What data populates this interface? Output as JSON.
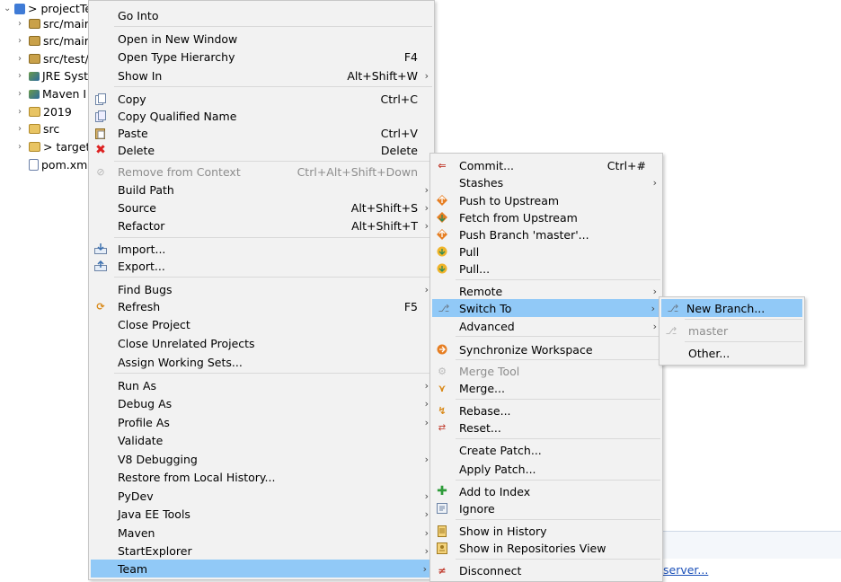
{
  "explorer": {
    "items": [
      {
        "label": "> projectTe",
        "icon": "project-icon"
      },
      {
        "label": "src/mair",
        "icon": "package-folder-icon"
      },
      {
        "label": "src/mair",
        "icon": "package-folder-icon"
      },
      {
        "label": "src/test/",
        "icon": "package-folder-icon"
      },
      {
        "label": "JRE Syst",
        "icon": "library-icon"
      },
      {
        "label": "Maven I",
        "icon": "library-icon"
      },
      {
        "label": "2019",
        "icon": "folder-icon"
      },
      {
        "label": "src",
        "icon": "folder-icon"
      },
      {
        "label": "> target",
        "icon": "folder-icon"
      },
      {
        "label": "pom.xm",
        "icon": "xml-file-icon"
      }
    ]
  },
  "context_menu": {
    "items": [
      {
        "label": "Go Into",
        "shortcut": ""
      },
      {
        "label": "Open in New Window",
        "shortcut": ""
      },
      {
        "label": "Open Type Hierarchy",
        "shortcut": "F4"
      },
      {
        "label": "Show In",
        "shortcut": "Alt+Shift+W"
      },
      {
        "label": "Copy",
        "shortcut": "Ctrl+C"
      },
      {
        "label": "Copy Qualified Name",
        "shortcut": ""
      },
      {
        "label": "Paste",
        "shortcut": "Ctrl+V"
      },
      {
        "label": "Delete",
        "shortcut": "Delete"
      },
      {
        "label": "Remove from Context",
        "shortcut": "Ctrl+Alt+Shift+Down"
      },
      {
        "label": "Build Path",
        "shortcut": ""
      },
      {
        "label": "Source",
        "shortcut": "Alt+Shift+S"
      },
      {
        "label": "Refactor",
        "shortcut": "Alt+Shift+T"
      },
      {
        "label": "Import...",
        "shortcut": ""
      },
      {
        "label": "Export...",
        "shortcut": ""
      },
      {
        "label": "Find Bugs",
        "shortcut": ""
      },
      {
        "label": "Refresh",
        "shortcut": "F5"
      },
      {
        "label": "Close Project",
        "shortcut": ""
      },
      {
        "label": "Close Unrelated Projects",
        "shortcut": ""
      },
      {
        "label": "Assign Working Sets...",
        "shortcut": ""
      },
      {
        "label": "Run As",
        "shortcut": ""
      },
      {
        "label": "Debug As",
        "shortcut": ""
      },
      {
        "label": "Profile As",
        "shortcut": ""
      },
      {
        "label": "Validate",
        "shortcut": ""
      },
      {
        "label": "V8 Debugging",
        "shortcut": ""
      },
      {
        "label": "Restore from Local History...",
        "shortcut": ""
      },
      {
        "label": "PyDev",
        "shortcut": ""
      },
      {
        "label": "Java EE Tools",
        "shortcut": ""
      },
      {
        "label": "Maven",
        "shortcut": ""
      },
      {
        "label": "StartExplorer",
        "shortcut": ""
      },
      {
        "label": "Team",
        "shortcut": ""
      }
    ]
  },
  "team_menu": {
    "items": [
      {
        "label": "Commit...",
        "shortcut": "Ctrl+#"
      },
      {
        "label": "Stashes",
        "shortcut": ""
      },
      {
        "label": "Push to Upstream",
        "shortcut": ""
      },
      {
        "label": "Fetch from Upstream",
        "shortcut": ""
      },
      {
        "label": "Push Branch 'master'...",
        "shortcut": ""
      },
      {
        "label": "Pull",
        "shortcut": ""
      },
      {
        "label": "Pull...",
        "shortcut": ""
      },
      {
        "label": "Remote",
        "shortcut": ""
      },
      {
        "label": "Switch To",
        "shortcut": ""
      },
      {
        "label": "Advanced",
        "shortcut": ""
      },
      {
        "label": "Synchronize Workspace",
        "shortcut": ""
      },
      {
        "label": "Merge Tool",
        "shortcut": ""
      },
      {
        "label": "Merge...",
        "shortcut": ""
      },
      {
        "label": "Rebase...",
        "shortcut": ""
      },
      {
        "label": "Reset...",
        "shortcut": ""
      },
      {
        "label": "Create Patch...",
        "shortcut": ""
      },
      {
        "label": "Apply Patch...",
        "shortcut": ""
      },
      {
        "label": "Add to Index",
        "shortcut": ""
      },
      {
        "label": "Ignore",
        "shortcut": ""
      },
      {
        "label": "Show in History",
        "shortcut": ""
      },
      {
        "label": "Show in Repositories View",
        "shortcut": ""
      },
      {
        "label": "Disconnect",
        "shortcut": ""
      }
    ]
  },
  "switch_menu": {
    "items": [
      {
        "label": "New Branch...",
        "shortcut": ""
      },
      {
        "label": "master",
        "shortcut": ""
      },
      {
        "label": "Other...",
        "shortcut": ""
      }
    ]
  },
  "background": {
    "server_link": "server..."
  },
  "colors": {
    "menu_bg": "#f2f2f2",
    "highlight": "#91c9f7",
    "disabled_text": "#8d8d8d"
  }
}
